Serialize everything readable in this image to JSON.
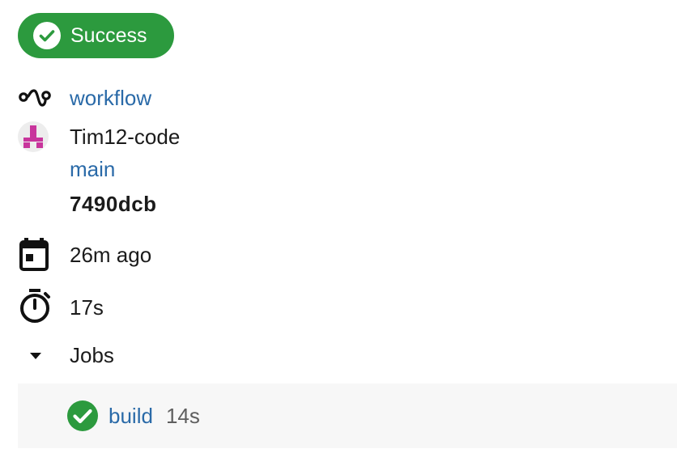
{
  "status": {
    "label": "Success",
    "icon": "check-circle-icon",
    "color": "#2c9a3e"
  },
  "workflow": {
    "icon": "workflow-icon",
    "name": "workflow"
  },
  "commit": {
    "avatar_icon": "identicon-avatar",
    "author": "Tim12-code",
    "branch": "main",
    "sha": "7490dcb"
  },
  "started": {
    "icon": "calendar-icon",
    "value": "26m ago"
  },
  "duration": {
    "icon": "timer-icon",
    "value": "17s"
  },
  "jobs": {
    "toggle_icon": "caret-down-icon",
    "label": "Jobs",
    "items": [
      {
        "name": "build",
        "duration": "14s",
        "status_icon": "check-circle-icon",
        "status_color": "#2c9a3e"
      }
    ]
  },
  "colors": {
    "link": "#2a6aa8",
    "success": "#2c9a3e",
    "panel_bg": "#f7f7f7"
  }
}
